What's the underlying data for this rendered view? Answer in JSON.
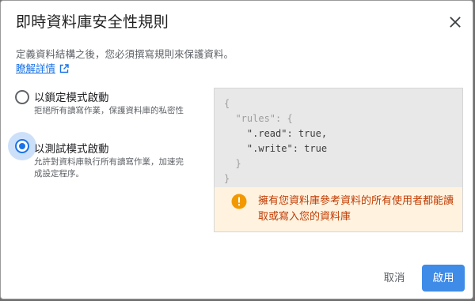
{
  "dialog": {
    "title": "即時資料庫安全性規則",
    "description": "定義資料結構之後，您必須撰寫規則來保護資料。",
    "learn_more": "瞭解詳情",
    "close_icon": "close-icon",
    "external_icon": "open-in-new-icon"
  },
  "options": [
    {
      "label": "以鎖定模式啟動",
      "description": "拒絕所有讀寫作業，保護資料庫的私密性",
      "selected": false
    },
    {
      "label": "以測試模式啟動",
      "description": "允許對資料庫執行所有讀寫作業，加速完成設定程序。",
      "selected": true
    }
  ],
  "code": {
    "lines": [
      "{",
      "  \"rules\": {",
      "    \".read\": true,",
      "    \".write\": true",
      "  }",
      "}"
    ]
  },
  "warning": {
    "icon": "warning-icon",
    "text": "擁有您資料庫參考資料的所有使用者都能讀取或寫入您的資料庫"
  },
  "buttons": {
    "cancel": "取消",
    "enable": "啟用"
  },
  "colors": {
    "accent": "#1a73e8",
    "primary_button": "#3f8be8",
    "warning_bg": "#fff3e0",
    "warning_text": "#c03a00",
    "warning_icon": "#f29900"
  }
}
